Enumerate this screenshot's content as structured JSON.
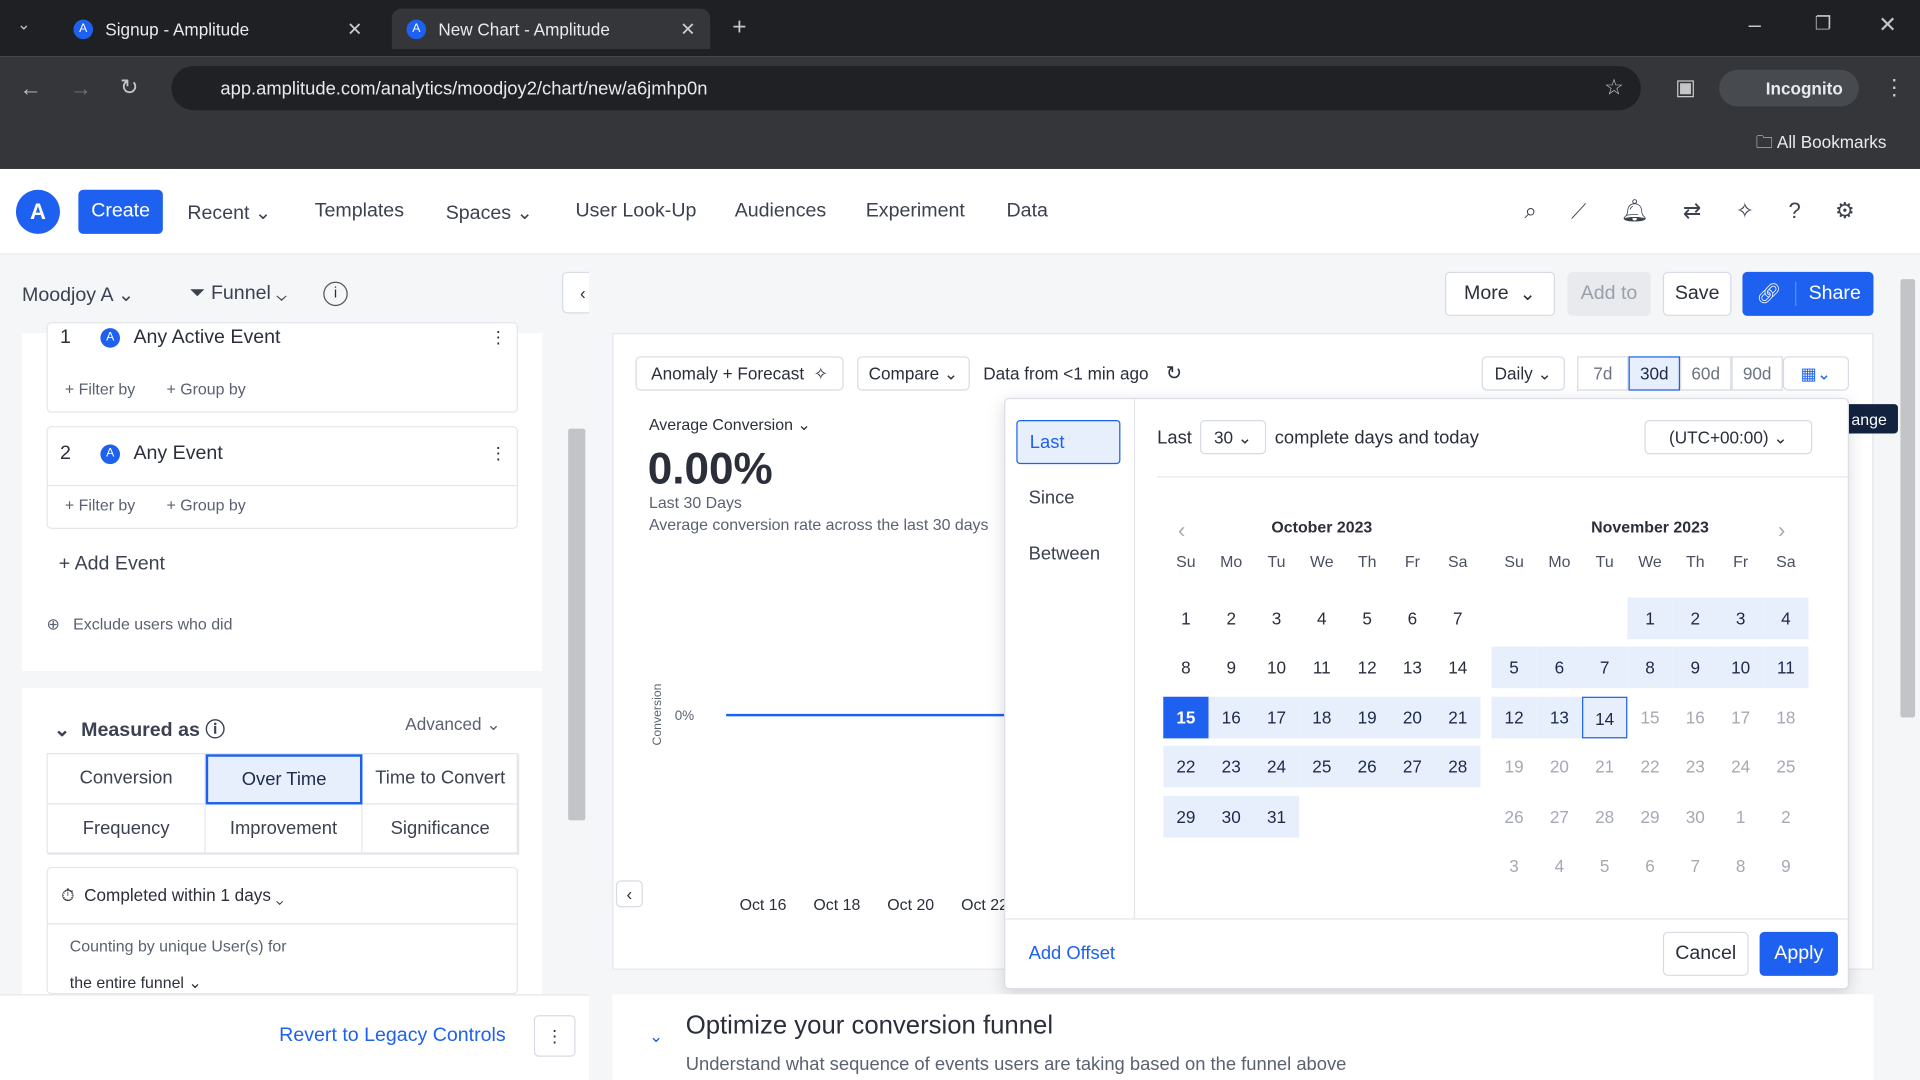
{
  "browser": {
    "tabs": [
      {
        "title": "Signup - Amplitude"
      },
      {
        "title": "New Chart - Amplitude"
      }
    ],
    "url": "app.amplitude.com/analytics/moodjoy2/chart/new/a6jmhp0n",
    "profile": "Incognito",
    "bookmarks": "All Bookmarks"
  },
  "nav": {
    "create": "Create",
    "items": [
      "Recent",
      "Templates",
      "Spaces",
      "User Look-Up",
      "Audiences",
      "Experiment",
      "Data"
    ]
  },
  "left": {
    "project": "Moodjoy A",
    "chart_type": "Funnel",
    "events": [
      {
        "num": "1",
        "name": "Any Active Event"
      },
      {
        "num": "2",
        "name": "Any Event"
      }
    ],
    "filter_by": "+ Filter by",
    "group_by": "+ Group by",
    "add_event": "+ Add Event",
    "exclude": "Exclude users who did",
    "measured_as": "Measured as",
    "advanced": "Advanced",
    "measure_tabs": [
      "Conversion",
      "Over Time",
      "Time to Convert",
      "Frequency",
      "Improvement",
      "Significance"
    ],
    "measure_selected": "Over Time",
    "completed": "Completed within 1 days",
    "counting": "Counting by unique User(s) for",
    "funnel_scope": "the entire funnel",
    "revert": "Revert to Legacy Controls"
  },
  "toolbar": {
    "more": "More",
    "add_to": "Add to",
    "save": "Save",
    "share": "Share"
  },
  "chart": {
    "anomaly": "Anomaly + Forecast",
    "compare": "Compare",
    "data_from": "Data from <1 min ago",
    "interval": "Daily",
    "ranges": [
      "7d",
      "30d",
      "60d",
      "90d"
    ],
    "range_selected": "30d",
    "metric": "Average Conversion",
    "value": "0.00%",
    "period": "Last 30 Days",
    "desc": "Average conversion rate across the last 30 days",
    "ylabel": "Conversion",
    "ytick": "0%",
    "xticks": [
      "Oct 16",
      "Oct 18",
      "Oct 20",
      "Oct 22"
    ],
    "tooltip": "ange"
  },
  "datepicker": {
    "modes": [
      "Last",
      "Since",
      "Between"
    ],
    "mode_selected": "Last",
    "last_label": "Last",
    "last_value": "30",
    "suffix": "complete days and today",
    "timezone": "(UTC+00:00)",
    "dow": [
      "Su",
      "Mo",
      "Tu",
      "We",
      "Th",
      "Fr",
      "Sa"
    ],
    "months": [
      {
        "title": "October 2023",
        "weeks": [
          [
            1,
            2,
            3,
            4,
            5,
            6,
            7
          ],
          [
            8,
            9,
            10,
            11,
            12,
            13,
            14
          ],
          [
            15,
            16,
            17,
            18,
            19,
            20,
            21
          ],
          [
            22,
            23,
            24,
            25,
            26,
            27,
            28
          ],
          [
            29,
            30,
            31,
            null,
            null,
            null,
            null
          ]
        ],
        "selected": [
          15
        ],
        "in_range_from": 16,
        "in_range_to": 31
      },
      {
        "title": "November 2023",
        "weeks": [
          [
            null,
            null,
            null,
            1,
            2,
            3,
            4
          ],
          [
            5,
            6,
            7,
            8,
            9,
            10,
            11
          ],
          [
            12,
            13,
            14,
            15,
            16,
            17,
            18
          ],
          [
            19,
            20,
            21,
            22,
            23,
            24,
            25
          ],
          [
            26,
            27,
            28,
            29,
            30,
            1,
            2
          ],
          [
            3,
            4,
            5,
            6,
            7,
            8,
            9
          ]
        ],
        "in_range_from": 1,
        "in_range_to": 14,
        "today": 14
      }
    ],
    "add_offset": "Add Offset",
    "cancel": "Cancel",
    "apply": "Apply"
  },
  "optimize": {
    "title": "Optimize your conversion funnel",
    "desc": "Understand what sequence of events users are taking based on the funnel above"
  },
  "colors": {
    "accent": "#1e61f0",
    "tab_bg": "#1f2023"
  }
}
